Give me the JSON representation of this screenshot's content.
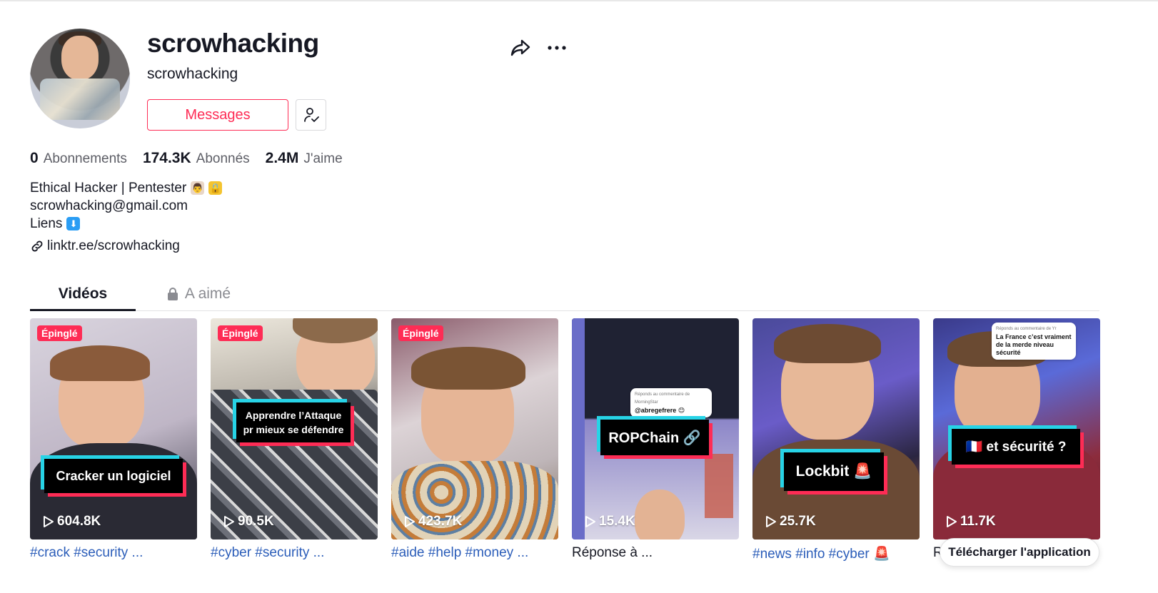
{
  "profile": {
    "username": "scrowhacking",
    "nickname": "scrowhacking",
    "messages_label": "Messages",
    "follow_icon": "user-check-icon",
    "share_icon": "share-arrow-icon",
    "more_icon": "more-dots-icon"
  },
  "stats": {
    "following_count": "0",
    "following_label": "Abonnements",
    "followers_count": "174.3K",
    "followers_label": "Abonnés",
    "likes_count": "2.4M",
    "likes_label": "J'aime"
  },
  "bio": {
    "line1": "Ethical Hacker | Pentester",
    "line2": "scrowhacking@gmail.com",
    "line3": "Liens",
    "link": "linktr.ee/scrowhacking"
  },
  "tabs": {
    "videos": "Vidéos",
    "liked": "A aimé"
  },
  "videos": [
    {
      "pinned": "Épinglé",
      "views": "604.8K",
      "overlay": "Cracker un logiciel",
      "caption": "#crack #security ..."
    },
    {
      "pinned": "Épinglé",
      "views": "90.5K",
      "overlay": "Apprendre l’Attaque pr mieux se défendre",
      "caption": "#cyber #security ..."
    },
    {
      "pinned": "Épinglé",
      "views": "423.7K",
      "overlay": "",
      "caption": "#aide #help #money ..."
    },
    {
      "pinned": "",
      "views": "15.4K",
      "overlay": "ROPChain 🔗",
      "comment_small": "Réponds au commentaire de MorningStar",
      "comment": "@abregefrere 😊",
      "caption": "Réponse à ..."
    },
    {
      "pinned": "",
      "views": "25.7K",
      "overlay": "Lockbit 🚨",
      "caption": "#news #info #cyber 🚨"
    },
    {
      "pinned": "",
      "views": "11.7K",
      "overlay": "🇫🇷 et sécurité ?",
      "comment_small": "Réponds au commentaire de Yr",
      "comment": "La France c’est vraiment de la merde niveau sécurité",
      "caption": "R"
    }
  ],
  "download_label": "Télécharger l'application",
  "colors": {
    "accent": "#fe2c55",
    "link": "#2b5db9",
    "cyan": "#27d3e6"
  }
}
